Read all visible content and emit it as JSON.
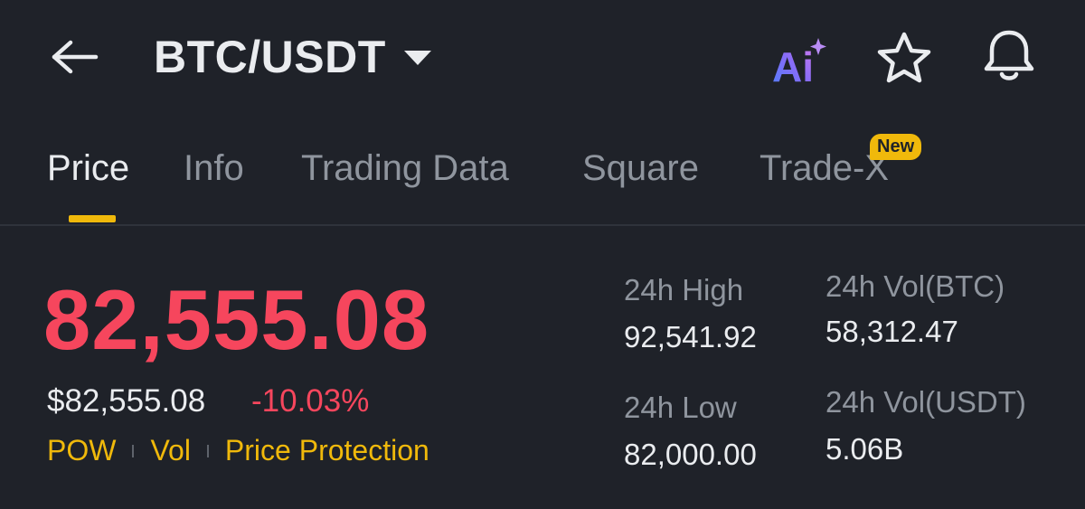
{
  "header": {
    "pair": "BTC/USDT",
    "ai_label": "Ai",
    "colors": {
      "background": "#1f2229",
      "accent": "#f0b90b",
      "down": "#f6465d"
    },
    "icons": [
      "back-arrow-icon",
      "chevron-down-icon",
      "ai-icon",
      "star-icon",
      "bell-icon"
    ]
  },
  "tabs": [
    {
      "label": "Price",
      "active": true
    },
    {
      "label": "Info",
      "active": false
    },
    {
      "label": "Trading Data",
      "active": false
    },
    {
      "label": "Square",
      "active": false
    },
    {
      "label": "Trade-X",
      "active": false,
      "badge": "New"
    }
  ],
  "price": {
    "last": "82,555.08",
    "usd": "$82,555.08",
    "change": "-10.03%",
    "tags": [
      "POW",
      "Vol",
      "Price Protection"
    ]
  },
  "stats": {
    "high_label": "24h High",
    "high_value": "92,541.92",
    "low_label": "24h Low",
    "low_value": "82,000.00",
    "vol_btc_label": "24h Vol(BTC)",
    "vol_btc_value": "58,312.47",
    "vol_usdt_label": "24h Vol(USDT)",
    "vol_usdt_value": "5.06B"
  }
}
